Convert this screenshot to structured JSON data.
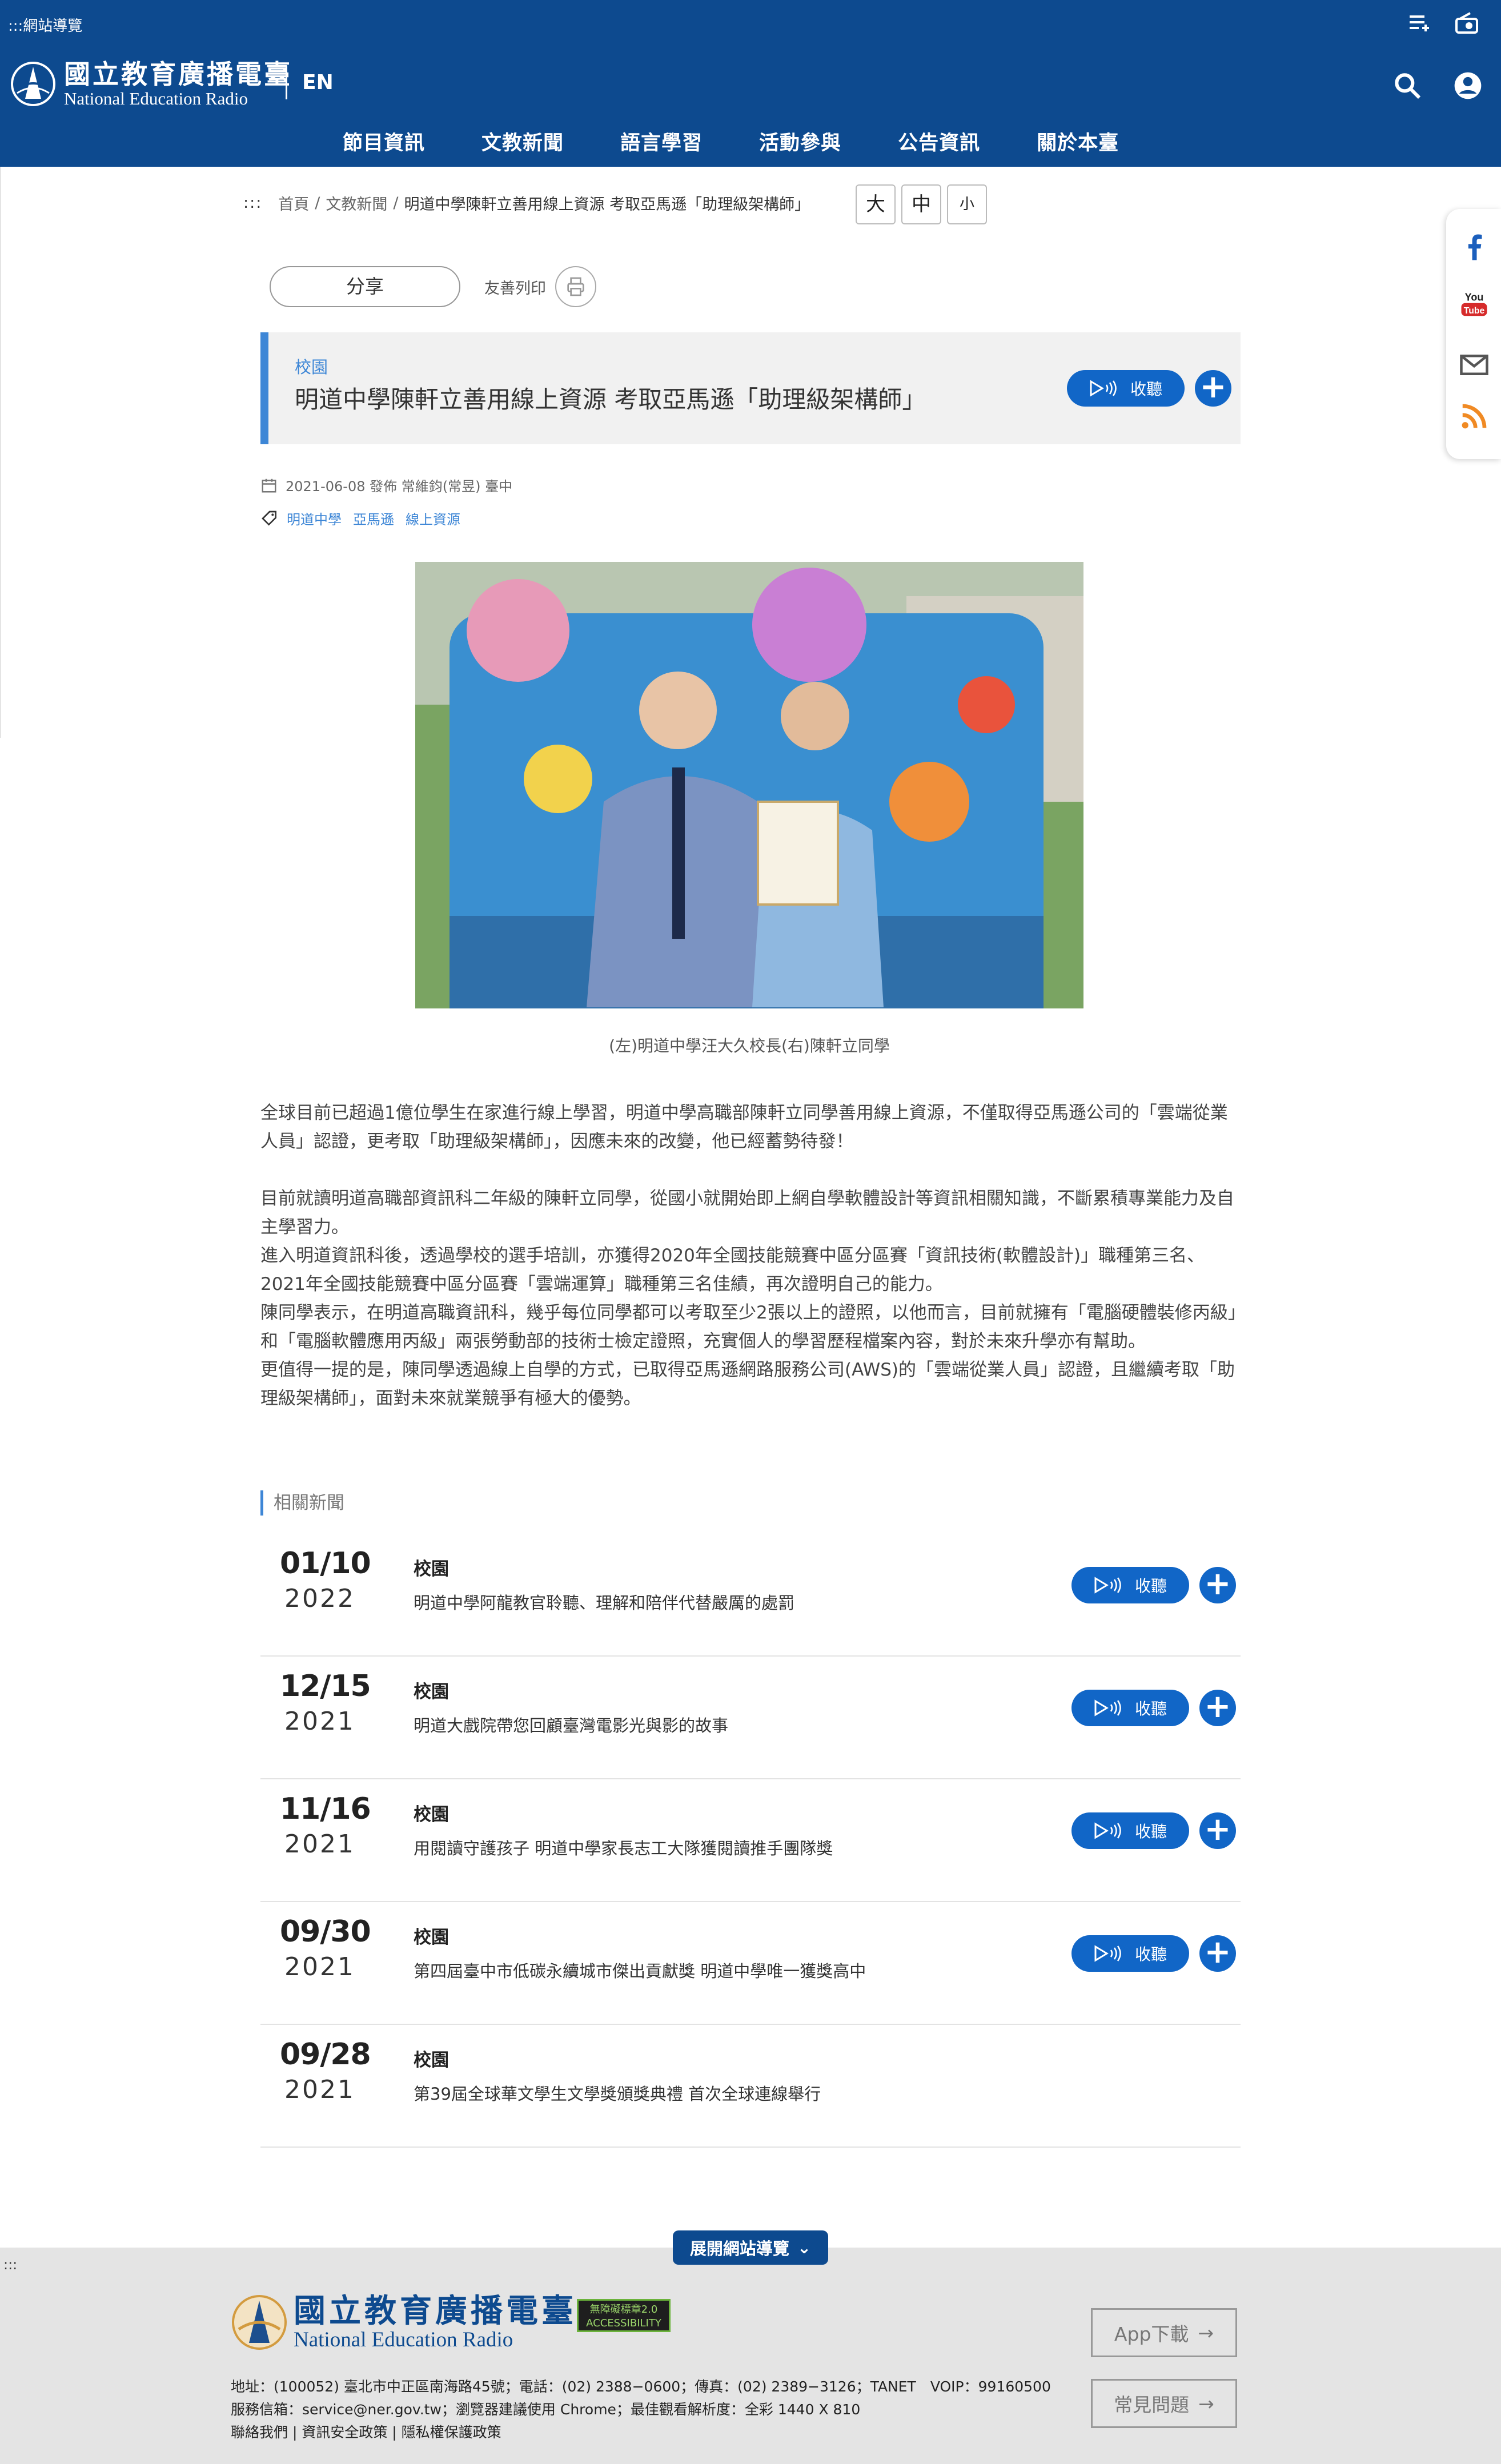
{
  "topbar": {
    "sitemap": ":::網站導覽",
    "icons": [
      "playlist-icon",
      "radio-icon"
    ]
  },
  "header": {
    "logo_zh": "國立教育廣播電臺",
    "logo_en": "National Education Radio",
    "lang": "EN",
    "nav": [
      "節目資訊",
      "文教新聞",
      "語言學習",
      "活動參與",
      "公告資訊",
      "關於本臺"
    ]
  },
  "breadcrumb": {
    "dots": ":::",
    "items": [
      "首頁",
      "文教新聞",
      "明道中學陳軒立善用線上資源 考取亞馬遜「助理級架構師」"
    ],
    "sep": "/"
  },
  "font_size": {
    "large": "大",
    "medium": "中",
    "small": "小"
  },
  "share_label": "分享",
  "print_label": "友善列印",
  "article": {
    "category": "校園",
    "title": "明道中學陳軒立善用線上資源 考取亞馬遜「助理級架構師」",
    "listen_label": "收聽",
    "meta": "2021-06-08 發佈 常維鈞(常昱) 臺中",
    "tags": [
      "明道中學",
      "亞馬遜",
      "線上資源"
    ],
    "photo_caption": "(左)明道中學汪大久校長(右)陳軒立同學",
    "paragraphs": [
      "全球目前已超過1億位學生在家進行線上學習，明道中學高職部陳軒立同學善用線上資源，不僅取得亞馬遜公司的「雲端從業人員」認證，更考取「助理級架構師」，因應未來的改變，他已經蓄勢待發！",
      "目前就讀明道高職部資訊科二年級的陳軒立同學，從國小就開始即上網自學軟體設計等資訊相關知識，不斷累積專業能力及自主學習力。",
      "進入明道資訊科後，透過學校的選手培訓，亦獲得2020年全國技能競賽中區分區賽「資訊技術(軟體設計)」職種第三名、2021年全國技能競賽中區分區賽「雲端運算」職種第三名佳績，再次證明自己的能力。",
      "陳同學表示，在明道高職資訊科，幾乎每位同學都可以考取至少2張以上的證照，以他而言，目前就擁有「電腦硬體裝修丙級」和「電腦軟體應用丙級」兩張勞動部的技術士檢定證照，充實個人的學習歷程檔案內容，對於未來升學亦有幫助。",
      "更值得一提的是，陳同學透過線上自學的方式，已取得亞馬遜網路服務公司(AWS)的「雲端從業人員」認證，且繼續考取「助理級架構師」，面對未來就業競爭有極大的優勢。"
    ]
  },
  "related": {
    "title": "相關新聞",
    "listen_label": "收聽",
    "items": [
      {
        "md": "01/10",
        "year": "2022",
        "category": "校園",
        "title": "明道中學阿龍教官聆聽、理解和陪伴代替嚴厲的處罰",
        "listen": true
      },
      {
        "md": "12/15",
        "year": "2021",
        "category": "校園",
        "title": "明道大戲院帶您回顧臺灣電影光與影的故事",
        "listen": true
      },
      {
        "md": "11/16",
        "year": "2021",
        "category": "校園",
        "title": "用閱讀守護孩子 明道中學家長志工大隊獲閱讀推手團隊獎",
        "listen": true
      },
      {
        "md": "09/30",
        "year": "2021",
        "category": "校園",
        "title": "第四屆臺中市低碳永續城市傑出貢獻獎 明道中學唯一獲獎高中",
        "listen": true
      },
      {
        "md": "09/28",
        "year": "2021",
        "category": "校園",
        "title": "第39屆全球華文學生文學獎頒獎典禮 首次全球連線舉行",
        "listen": false
      }
    ]
  },
  "social": [
    "facebook-icon",
    "youtube-icon",
    "mail-icon",
    "rss-icon"
  ],
  "footer": {
    "dots": ":::",
    "expand_label": "展開網站導覽",
    "logo_zh": "國立教育廣播電臺",
    "logo_en": "National Education Radio",
    "badge_line1": "無障礙標章2.0",
    "badge_line2": "ACCESSIBILITY",
    "address_lines": [
      "地址：(100052) 臺北市中正區南海路45號；電話：(02) 2388−0600；傳真：(02) 2389−3126；TANET　VOIP：99160500",
      "服務信箱：service@ner.gov.tw；瀏覽器建議使用 Chrome；最佳觀看解析度：全彩 1440 X 810",
      "聯絡我們 | 資訊安全政策 | 隱私權保護政策"
    ],
    "app_label": "App下載",
    "faq_label": "常見問題"
  },
  "colors": {
    "brand": "#0d4a8f",
    "accent": "#1166c7",
    "link": "#3d86d6"
  }
}
